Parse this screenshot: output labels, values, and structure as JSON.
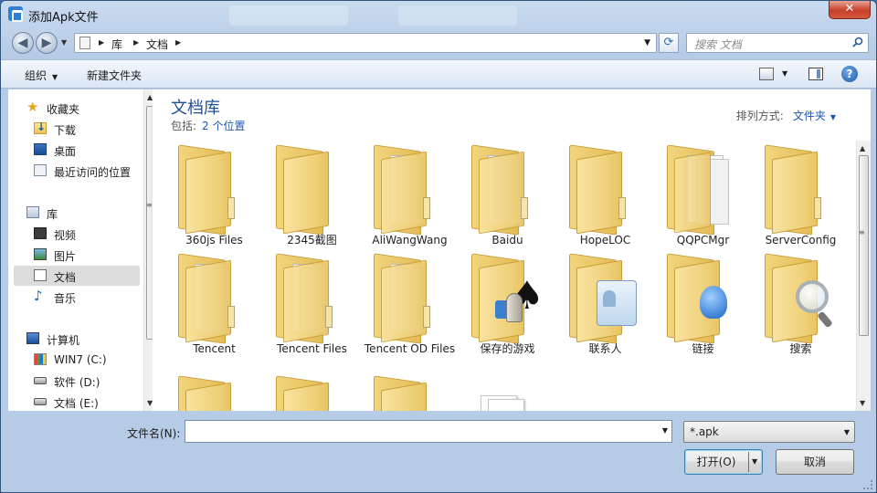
{
  "window": {
    "title": "添加Apk文件",
    "close_glyph": "✕"
  },
  "address": {
    "segments": [
      "库",
      "文档"
    ]
  },
  "search": {
    "placeholder": "搜索 文档"
  },
  "toolbar": {
    "organize_label": "组织",
    "new_folder_label": "新建文件夹"
  },
  "sidebar": {
    "favorites": {
      "label": "收藏夹",
      "items": [
        {
          "label": "下载",
          "icon": "download-folder-icon"
        },
        {
          "label": "桌面",
          "icon": "desktop-icon"
        },
        {
          "label": "最近访问的位置",
          "icon": "recent-places-icon"
        }
      ]
    },
    "libraries": {
      "label": "库",
      "items": [
        {
          "label": "视频",
          "icon": "video-library-icon"
        },
        {
          "label": "图片",
          "icon": "pictures-library-icon"
        },
        {
          "label": "文档",
          "icon": "documents-library-icon",
          "selected": true
        },
        {
          "label": "音乐",
          "icon": "music-library-icon"
        }
      ]
    },
    "computer": {
      "label": "计算机",
      "items": [
        {
          "label": "WIN7 (C:)",
          "icon": "windows-drive-icon"
        },
        {
          "label": "软件 (D:)",
          "icon": "drive-icon"
        },
        {
          "label": "文档 (E:)",
          "icon": "drive-icon"
        }
      ]
    }
  },
  "content": {
    "library_title": "文档库",
    "includes_prefix": "包括:",
    "includes_link": "2 个位置",
    "arrange_label": "排列方式:",
    "arrange_value": "文件夹",
    "items": [
      {
        "label": "360js Files"
      },
      {
        "label": "2345截图"
      },
      {
        "label": "AliWangWang"
      },
      {
        "label": "Baidu"
      },
      {
        "label": "HopeLOC"
      },
      {
        "label": "QQPCMgr"
      },
      {
        "label": "ServerConfig"
      },
      {
        "label": "Tencent"
      },
      {
        "label": "Tencent Files"
      },
      {
        "label": "Tencent OD Files"
      },
      {
        "label": "保存的游戏"
      },
      {
        "label": "联系人"
      },
      {
        "label": "链接"
      },
      {
        "label": "搜索"
      }
    ]
  },
  "footer": {
    "filename_label": "文件名(N):",
    "filename_value": "",
    "filetype_value": "*.apk",
    "open_label": "打开(O)",
    "cancel_label": "取消"
  },
  "colors": {
    "title_blue": "#1e4f94",
    "link_blue": "#1c57b8",
    "frame": "#b6cbe6"
  }
}
